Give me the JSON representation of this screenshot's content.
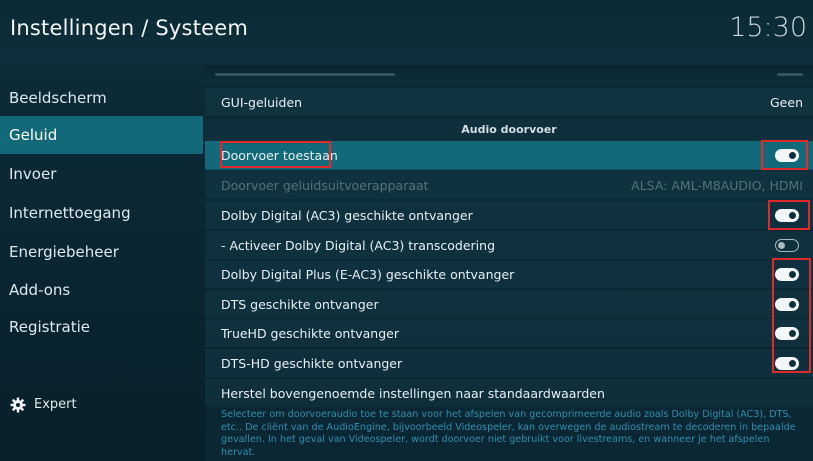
{
  "header": {
    "title": "Instellingen / Systeem",
    "time": "15:30"
  },
  "sidebar": {
    "items": [
      {
        "label": "Beeldscherm"
      },
      {
        "label": "Geluid"
      },
      {
        "label": "Invoer"
      },
      {
        "label": "Internettoegang"
      },
      {
        "label": "Energiebeheer"
      },
      {
        "label": "Add-ons"
      },
      {
        "label": "Registratie"
      }
    ],
    "expert_label": "Expert"
  },
  "settings": {
    "gui_sounds": {
      "label": "GUI-geluiden",
      "value": "Geen"
    },
    "section_title": "Audio doorvoer",
    "rows": [
      {
        "label": "Doorvoer toestaan",
        "toggle": "on"
      },
      {
        "label": "Doorvoer geluidsuitvoerapparaat",
        "value": "ALSA: AML-M8AUDIO, HDMI"
      },
      {
        "label": "Dolby Digital (AC3) geschikte ontvanger",
        "toggle": "on"
      },
      {
        "label": "- Activeer Dolby Digital (AC3) transcodering",
        "toggle": "off"
      },
      {
        "label": "Dolby Digital Plus (E-AC3) geschikte ontvanger",
        "toggle": "on"
      },
      {
        "label": "DTS geschikte ontvanger",
        "toggle": "on"
      },
      {
        "label": "TrueHD geschikte ontvanger",
        "toggle": "on"
      },
      {
        "label": "DTS-HD geschikte ontvanger",
        "toggle": "on"
      }
    ],
    "reset_label": "Herstel bovengenoemde instellingen naar standaardwaarden",
    "description": "Selecteer om doorvoeraudio toe te staan voor het afspelen van gecomprimeerde audio zoals Dolby Digital (AC3), DTS, etc.. De cliënt van de AudioEngine, bijvoorbeeld Videospeler, kan overwegen de audiostream te decoderen in bepaalde gevallen. In het geval van Videospeler, wordt doorvoer niet gebruikt voor livestreams, en wanneer je het afspelen hervat."
  },
  "colors": {
    "accent": "#12697a",
    "highlight_box": "#e02a2a",
    "description_text": "#2d8fb0"
  }
}
